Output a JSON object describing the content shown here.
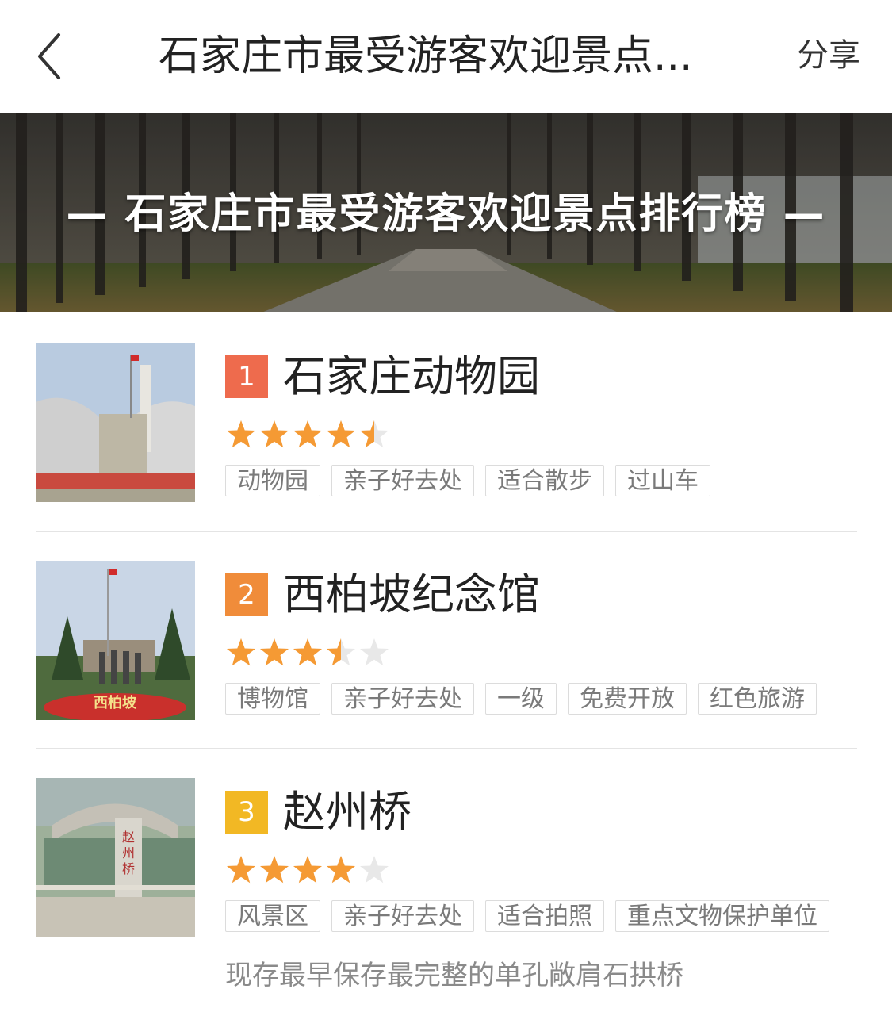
{
  "header": {
    "back_icon": "chevron-left-icon",
    "title": "石家庄市最受游客欢迎景点...",
    "share_label": "分享"
  },
  "banner": {
    "title": "— 石家庄市最受游客欢迎景点排行榜 —"
  },
  "items": [
    {
      "rank": "1",
      "rank_color": "#ee6b4d",
      "name": "石家庄动物园",
      "rating": 4.5,
      "tags": [
        "动物园",
        "亲子好去处",
        "适合散步",
        "过山车"
      ]
    },
    {
      "rank": "2",
      "rank_color": "#f08c3a",
      "name": "西柏坡纪念馆",
      "rating": 3.5,
      "tags": [
        "博物馆",
        "亲子好去处",
        "一级",
        "免费开放",
        "红色旅游"
      ]
    },
    {
      "rank": "3",
      "rank_color": "#f2b824",
      "name": "赵州桥",
      "rating": 4.0,
      "tags": [
        "风景区",
        "亲子好去处",
        "适合拍照",
        "重点文物保护单位"
      ],
      "description": "现存最早保存最完整的单孔敞肩石拱桥"
    }
  ],
  "colors": {
    "star_on": "#f59a34",
    "star_off": "#e8e8e8"
  }
}
